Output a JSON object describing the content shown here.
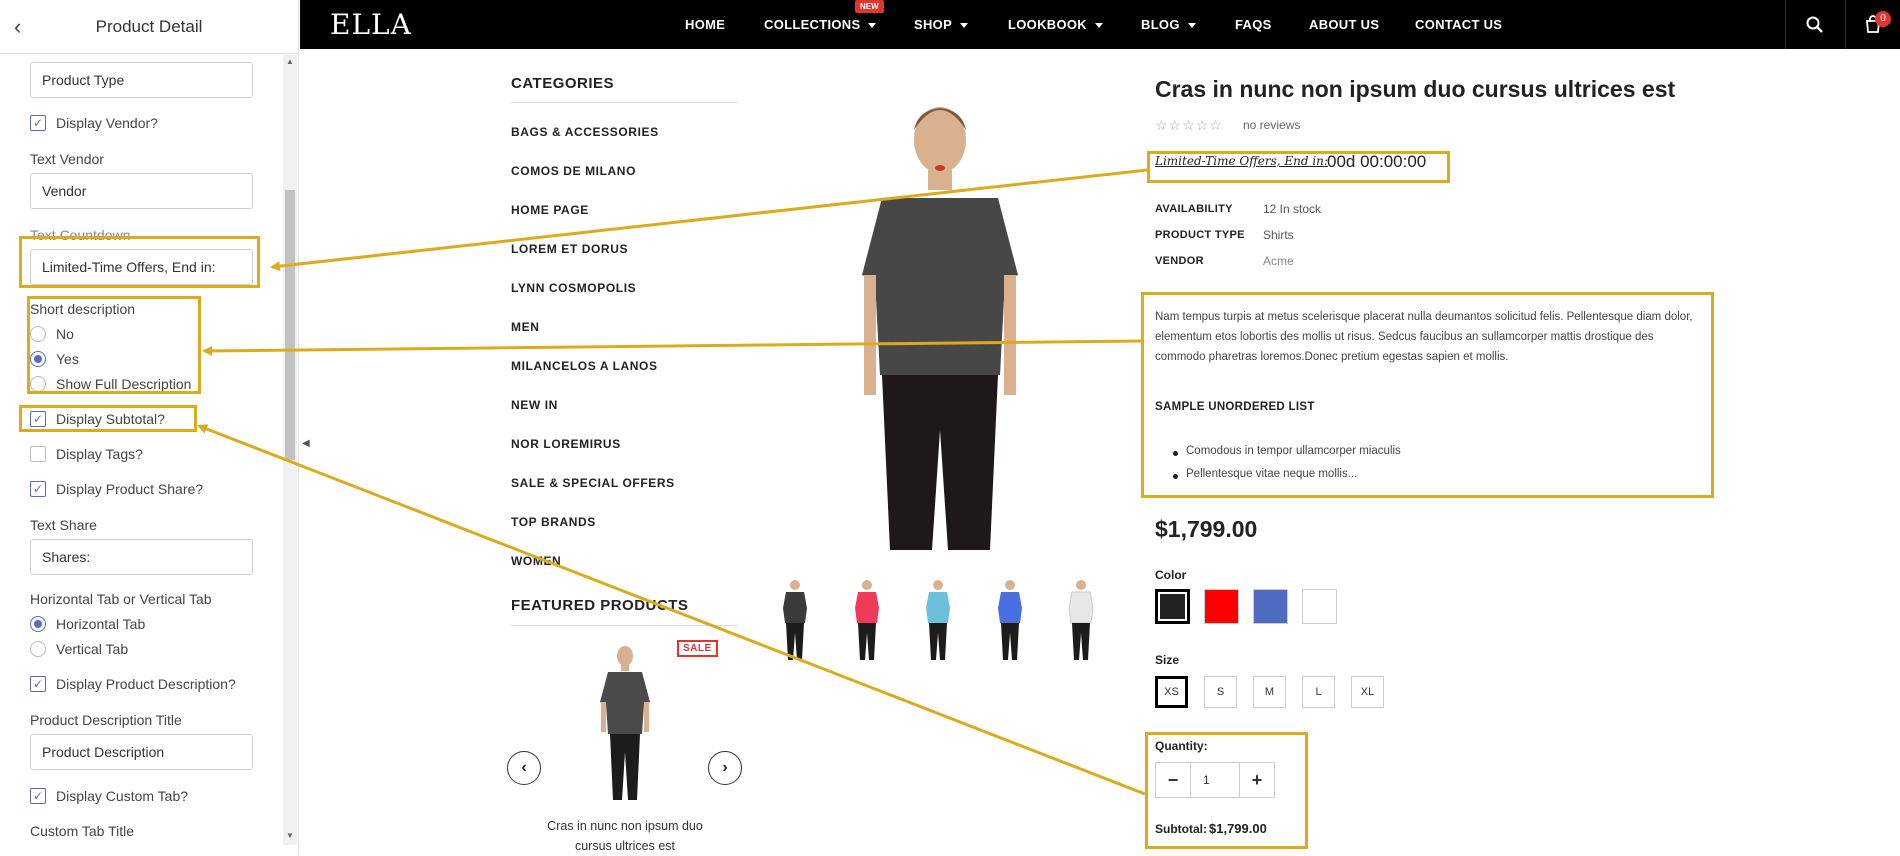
{
  "sidebar": {
    "title": "Product Detail",
    "product_type_value": "Product Type",
    "display_vendor": "Display Vendor?",
    "text_vendor_label": "Text Vendor",
    "vendor_value": "Vendor",
    "text_countdown_label": "Text Countdown",
    "countdown_value": "Limited-Time Offers, End in:",
    "short_desc_label": "Short description",
    "short_desc_options": [
      "No",
      "Yes",
      "Show Full Description"
    ],
    "short_desc_selected": "Yes",
    "display_subtotal": "Display Subtotal?",
    "display_tags": "Display Tags?",
    "display_share": "Display Product Share?",
    "text_share_label": "Text Share",
    "share_value": "Shares:",
    "tab_label": "Horizontal Tab or Vertical Tab",
    "tab_options": [
      "Horizontal Tab",
      "Vertical Tab"
    ],
    "tab_selected": "Horizontal Tab",
    "display_desc": "Display Product Description?",
    "desc_title_label": "Product Description Title",
    "desc_title_value": "Product Description",
    "display_custom": "Display Custom Tab?",
    "custom_tab_label": "Custom Tab Title"
  },
  "nav": {
    "logo": "ELLA",
    "items": [
      "HOME",
      "COLLECTIONS",
      "SHOP",
      "LOOKBOOK",
      "BLOG",
      "FAQS",
      "ABOUT US",
      "CONTACT US"
    ],
    "new_badge": "NEW",
    "cart_count": "0"
  },
  "categories": {
    "title": "CATEGORIES",
    "items": [
      "BAGS & ACCESSORIES",
      "COMOS DE MILANO",
      "HOME PAGE",
      "LOREM ET DORUS",
      "LYNN COSMOPOLIS",
      "MEN",
      "MILANCELOS A LANOS",
      "NEW IN",
      "NOR LOREMIRUS",
      "SALE & SPECIAL OFFERS",
      "TOP BRANDS",
      "WOMEN"
    ]
  },
  "featured": {
    "title": "FEATURED PRODUCTS",
    "sale_badge": "SALE",
    "product_name": "Cras in nunc non ipsum duo cursus ultrices est"
  },
  "product": {
    "title": "Cras in nunc non ipsum duo cursus ultrices est",
    "reviews": "no reviews",
    "countdown_text": "Limited-Time Offers, End in:",
    "countdown_time": "00d 00:00:00",
    "availability_label": "AVAILABILITY",
    "availability": "12 In stock",
    "type_label": "PRODUCT TYPE",
    "type": "Shirts",
    "vendor_label": "VENDOR",
    "vendor": "Acme",
    "description": "Nam tempus turpis at metus scelerisque placerat nulla deumantos solicitud felis. Pellentesque diam dolor, elementum etos lobortis des mollis ut risus. Sedcus faucibus an sullamcorper mattis drostique des commodo pharetras loremos.Donec pretium egestas sapien et mollis.",
    "list_title": "SAMPLE UNORDERED LIST",
    "list_items": [
      "Comodous in tempor ullamcorper miaculis",
      "Pellentesque vitae neque mollis..."
    ],
    "price": "$1,799.00",
    "color_label": "Color",
    "colors": [
      "#222222",
      "#ff0000",
      "#4f6bc0",
      "#ffffff"
    ],
    "size_label": "Size",
    "sizes": [
      "XS",
      "S",
      "M",
      "L",
      "XL"
    ],
    "selected_size": "XS",
    "quantity_label": "Quantity:",
    "quantity": "1",
    "subtotal_label": "Subtotal:",
    "subtotal": "$1,799.00",
    "thumbnail_colors": [
      "#3b3b3b",
      "#ee3b5a",
      "#6cc0d9",
      "#4a6fe0",
      "#eeeeee"
    ]
  },
  "annotation_color": "#dcab1d"
}
